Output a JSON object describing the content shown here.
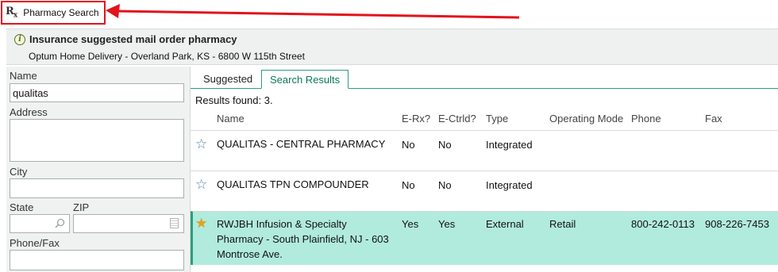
{
  "window": {
    "title": "Pharmacy Search",
    "icon": "rx-icon"
  },
  "banner": {
    "title": "Insurance suggested mail order pharmacy",
    "subtitle": "Optum Home Delivery - Overland Park, KS - 6800 W 115th Street",
    "icon": "info-icon"
  },
  "search_form": {
    "name_label": "Name",
    "name_value": "qualitas",
    "address_label": "Address",
    "address_value": "",
    "city_label": "City",
    "city_value": "",
    "state_label": "State",
    "state_value": "",
    "zip_label": "ZIP",
    "zip_value": "",
    "phone_fax_label": "Phone/Fax",
    "phone_fax_value": ""
  },
  "tabs": [
    {
      "label": "Suggested",
      "active": false
    },
    {
      "label": "Search Results",
      "active": true
    }
  ],
  "results": {
    "count_text": "Results found: 3.",
    "columns": [
      "Name",
      "E-Rx?",
      "E-Ctrld?",
      "Type",
      "Operating Mode",
      "Phone",
      "Fax"
    ],
    "rows": [
      {
        "favorite": false,
        "name_lines": [
          "QUALITAS - CENTRAL PHARMACY"
        ],
        "erx": "No",
        "ectrld": "No",
        "type": "Integrated",
        "mode": "",
        "phone": "",
        "fax": ""
      },
      {
        "favorite": false,
        "name_lines": [
          "QUALITAS TPN COMPOUNDER"
        ],
        "erx": "No",
        "ectrld": "No",
        "type": "Integrated",
        "mode": "",
        "phone": "",
        "fax": ""
      },
      {
        "favorite": true,
        "selected": true,
        "name_lines": [
          "RWJBH Infusion & Specialty",
          "Pharmacy - South Plainfield, NJ - 603",
          "Montrose Ave."
        ],
        "erx": "Yes",
        "ectrld": "Yes",
        "type": "External",
        "mode": "Retail",
        "phone": "800-242-0113",
        "fax": "908-226-7453"
      }
    ]
  },
  "colors": {
    "highlight": "#e2131b",
    "accent": "#2e9e7a",
    "selected_row": "#b1ebde",
    "star_filled": "#e3a21a",
    "star_empty": "#5a7da6"
  }
}
